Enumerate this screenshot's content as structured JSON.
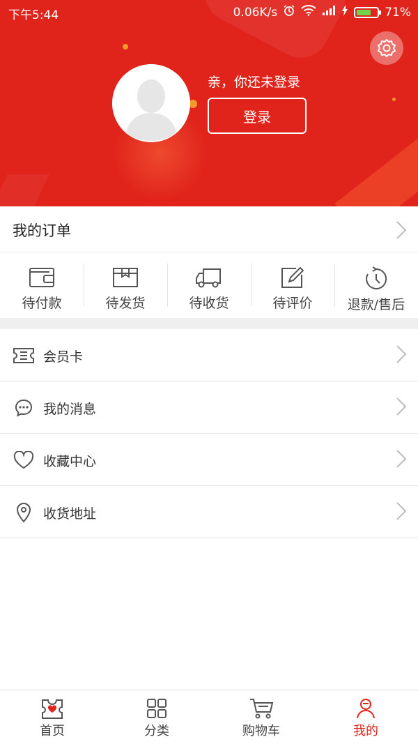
{
  "status_bar": {
    "time": "下午5:44",
    "speed": "0.06K/s",
    "battery_text": "71%",
    "battery_level": 0.71
  },
  "profile": {
    "greeting": "亲，你还未登录",
    "login_label": "登录"
  },
  "orders": {
    "title": "我的订单",
    "items": [
      {
        "label": "待付款",
        "icon": "wallet-icon"
      },
      {
        "label": "待发货",
        "icon": "box-icon"
      },
      {
        "label": "待收货",
        "icon": "truck-icon"
      },
      {
        "label": "待评价",
        "icon": "edit-icon"
      },
      {
        "label": "退款/售后",
        "icon": "refund-icon"
      }
    ]
  },
  "menu": [
    {
      "label": "会员卡",
      "icon": "member-card-icon"
    },
    {
      "label": "我的消息",
      "icon": "message-icon"
    },
    {
      "label": "收藏中心",
      "icon": "heart-icon"
    },
    {
      "label": "收货地址",
      "icon": "location-icon"
    }
  ],
  "bottom_nav": [
    {
      "label": "首页",
      "icon": "home-icon"
    },
    {
      "label": "分类",
      "icon": "category-icon"
    },
    {
      "label": "购物车",
      "icon": "cart-icon"
    },
    {
      "label": "我的",
      "icon": "user-icon",
      "active": true
    }
  ],
  "colors": {
    "brand_red": "#e0231b",
    "accent_orange": "#f39a2d"
  }
}
